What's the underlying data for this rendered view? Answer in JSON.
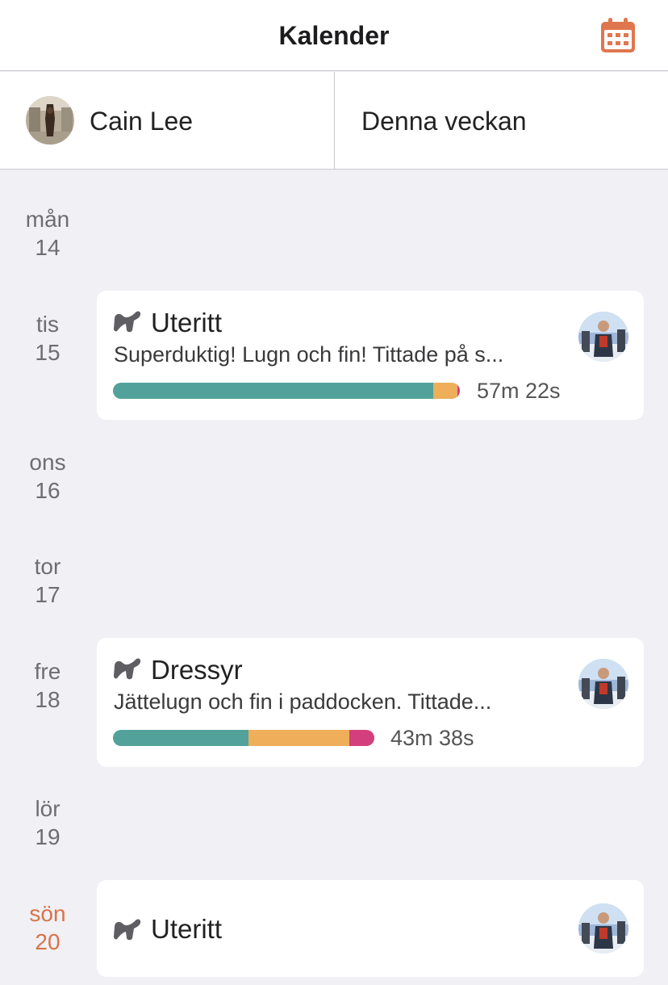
{
  "header": {
    "title": "Kalender",
    "calendar_icon_color": "#e0764e"
  },
  "selectors": {
    "user_name": "Cain Lee",
    "period": "Denna veckan"
  },
  "colors": {
    "walk": "#52a29b",
    "trot": "#eeae5a",
    "canter": "#d33e7c",
    "today": "#d8734a"
  },
  "days": [
    {
      "weekday": "mån",
      "date": "14"
    },
    {
      "weekday": "tis",
      "date": "15"
    },
    {
      "weekday": "ons",
      "date": "16"
    },
    {
      "weekday": "tor",
      "date": "17"
    },
    {
      "weekday": "fre",
      "date": "18"
    },
    {
      "weekday": "lör",
      "date": "19"
    },
    {
      "weekday": "sön",
      "date": "20"
    }
  ],
  "sessions": [
    {
      "day": "tis 15",
      "type": "Uteritt",
      "icon": "saddle-icon",
      "description": "Superduktig! Lugn och fin! Tittade på s...",
      "duration": "57m 22s",
      "gait_fraction": {
        "walk": 0.923,
        "trot": 0.07,
        "canter": 0.007
      }
    },
    {
      "day": "fre 18",
      "type": "Dressyr",
      "icon": "saddle-icon",
      "description": "Jättelugn och fin i paddocken. Tittade...",
      "duration": "43m 38s",
      "gait_fraction": {
        "walk": 0.52,
        "trot": 0.385,
        "canter": 0.095
      }
    },
    {
      "day": "sön 20",
      "type": "Uteritt",
      "icon": "saddle-icon"
    }
  ]
}
